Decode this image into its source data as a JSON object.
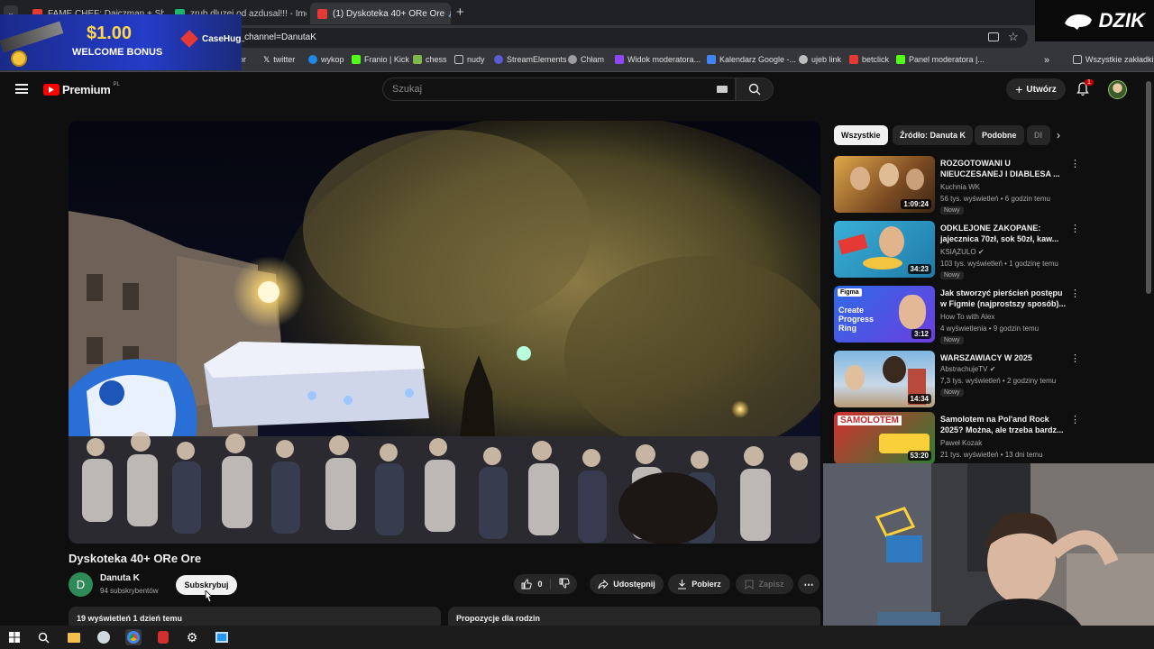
{
  "browser": {
    "tabs": [
      {
        "label": "FAME CHEF: Dajczman + Sh",
        "color": "#e53935"
      },
      {
        "label": "zrub dluzej od azdusal!!! - Img",
        "color": "#1bb76e"
      },
      {
        "label": "(1) Dyskoteka 40+ ORe Ore",
        "color": "#e53935"
      }
    ],
    "new_tab": "+",
    "url": "b_channel=DanutaK",
    "bookmarks": [
      {
        "label": "alior",
        "color": "#c62828"
      },
      {
        "label": "twitter",
        "color": "#ffffff"
      },
      {
        "label": "wykop",
        "color": "#1e88e5"
      },
      {
        "label": "Franio | Kick",
        "color": "#53fc18"
      },
      {
        "label": "chess",
        "color": "#81b64c"
      },
      {
        "label": "nudy",
        "color": "#bdbdbd"
      },
      {
        "label": "StreamElements",
        "color": "#5b5bd6"
      },
      {
        "label": "Chłam",
        "color": "#9e9e9e"
      },
      {
        "label": "Widok moderatora...",
        "color": "#9146ff"
      },
      {
        "label": "Kalendarz Google -...",
        "color": "#4285f4"
      },
      {
        "label": "ujeb link",
        "color": "#bdbdbd"
      },
      {
        "label": "betclick",
        "color": "#e53935"
      },
      {
        "label": "Panel moderatora |...",
        "color": "#53fc18"
      }
    ],
    "all_bookmarks": "Wszystkie zakładki"
  },
  "promo": {
    "price": "$1.00",
    "subtitle": "WELCOME BONUS",
    "brand": "CaseHug"
  },
  "streamer_logo": "DZIK",
  "youtube": {
    "logo": "Premium",
    "logo_sup": "PL",
    "search_placeholder": "Szukaj",
    "create_label": "Utwórz",
    "notif_count": "1"
  },
  "video": {
    "title": "Dyskoteka 40+ ORe Ore",
    "channel": "Danuta K",
    "channel_initial": "D",
    "subscribers": "94 subskrybentów",
    "subscribe_label": "Subskrybuj",
    "likes": "0",
    "share_label": "Udostępnij",
    "download_label": "Pobierz",
    "save_label": "Zapisz",
    "stats": "19 wyświetleń  1 dzień temu",
    "family_label": "Propozycje dla rodzin"
  },
  "filters": [
    "Wszystkie",
    "Źródło: Danuta K",
    "Podobne",
    "Dl"
  ],
  "recommendations": [
    {
      "title": "ROZGOTOWANI U NIEUCZESANEJ I DIABLESA ...",
      "channel": "Kuchnia WK",
      "meta": "56 tys. wyświetleń • 6 godzin temu",
      "badge": "Nowy",
      "duration": "1:09:24",
      "colors": [
        "#c08a3a",
        "#5a3a22"
      ]
    },
    {
      "title": "ODKLEJONE ZAKOPANE: jajecznica 70zł, sok 50zł, kaw...",
      "channel": "KSIĄŻULO",
      "meta": "103 tys. wyświetleń • 1 godzinę temu",
      "badge": "Nowy",
      "duration": "34:23",
      "colors": [
        "#2aa4c8",
        "#e04a3a"
      ]
    },
    {
      "title": "Jak stworzyć pierścień postępu w Figmie (najprostszy sposób)...",
      "channel": "How To with Alex",
      "meta": "4 wyświetlenia • 9 godzin temu",
      "badge": "Nowy",
      "duration": "3:12",
      "colors": [
        "#3b6fe0",
        "#6a3de0"
      ],
      "thumb_text": "Create Progress Ring",
      "thumb_tag": "Figma"
    },
    {
      "title": "WARSZAWIACY W 2025",
      "channel": "AbstrachujeTV",
      "meta": "7,3 tys. wyświetleń • 2 godziny temu",
      "badge": "Nowy",
      "duration": "14:34",
      "colors": [
        "#6fa8d8",
        "#d9c7a8"
      ]
    },
    {
      "title": "Samolotem na Pol'and Rock 2025? Można, ale trzeba bardz...",
      "channel": "Paweł Kozak",
      "meta": "21 tys. wyświetleń • 13 dni temu",
      "badge": "",
      "duration": "53:20",
      "colors": [
        "#2e7d32",
        "#c62828"
      ],
      "thumb_text": "SAMOLOTEM"
    }
  ]
}
